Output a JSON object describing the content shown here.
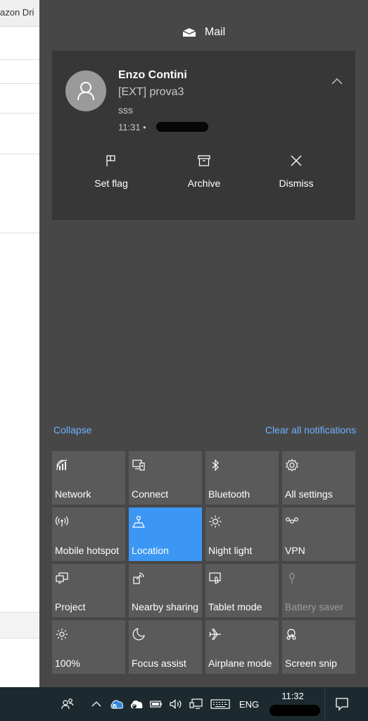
{
  "background_app": {
    "tab_title": "azon Dri"
  },
  "mail": {
    "header_title": "Mail",
    "notification": {
      "sender": "Enzo Contini",
      "subject": "[EXT] prova3",
      "preview": "sss",
      "time": "11:31 •"
    },
    "actions": [
      {
        "label": "Set flag",
        "icon": "flag-icon"
      },
      {
        "label": "Archive",
        "icon": "archive-icon"
      },
      {
        "label": "Dismiss",
        "icon": "close-icon"
      }
    ]
  },
  "links": {
    "collapse": "Collapse",
    "clear_all": "Clear all notifications"
  },
  "quick_actions": [
    {
      "label": "Network",
      "icon": "network-icon",
      "state": "off"
    },
    {
      "label": "Connect",
      "icon": "connect-icon",
      "state": "off"
    },
    {
      "label": "Bluetooth",
      "icon": "bluetooth-icon",
      "state": "off"
    },
    {
      "label": "All settings",
      "icon": "gear-icon",
      "state": "off"
    },
    {
      "label": "Mobile hotspot",
      "icon": "hotspot-icon",
      "state": "off"
    },
    {
      "label": "Location",
      "icon": "location-icon",
      "state": "on"
    },
    {
      "label": "Night light",
      "icon": "night-light-icon",
      "state": "off"
    },
    {
      "label": "VPN",
      "icon": "vpn-icon",
      "state": "off"
    },
    {
      "label": "Project",
      "icon": "project-icon",
      "state": "off"
    },
    {
      "label": "Nearby sharing",
      "icon": "nearby-sharing-icon",
      "state": "off"
    },
    {
      "label": "Tablet mode",
      "icon": "tablet-mode-icon",
      "state": "off"
    },
    {
      "label": "Battery saver",
      "icon": "battery-saver-icon",
      "state": "disabled"
    },
    {
      "label": "100%",
      "icon": "brightness-icon",
      "state": "off"
    },
    {
      "label": "Focus assist",
      "icon": "moon-icon",
      "state": "off"
    },
    {
      "label": "Airplane mode",
      "icon": "airplane-icon",
      "state": "off"
    },
    {
      "label": "Screen snip",
      "icon": "screen-snip-icon",
      "state": "off"
    }
  ],
  "taskbar": {
    "language": "ENG",
    "time": "11:32"
  },
  "colors": {
    "panel_bg": "#474747",
    "card_bg": "#373737",
    "tile_bg": "#5a5a5a",
    "tile_active": "#3b97f3",
    "link": "#6cb3ff",
    "taskbar_bg": "#1c2a2f"
  }
}
